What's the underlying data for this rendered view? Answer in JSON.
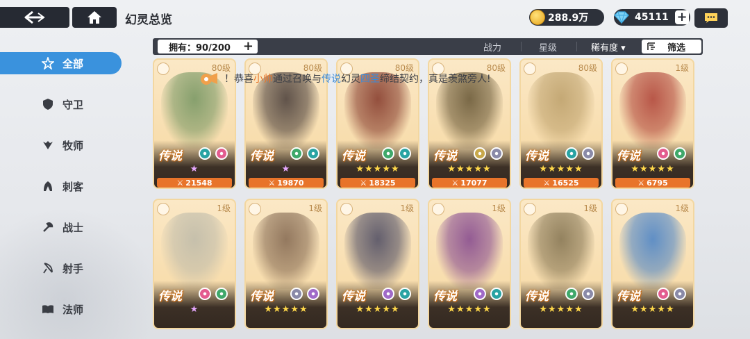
{
  "header": {
    "title": "幻灵总览",
    "gold": "288.9万",
    "gems": "45111",
    "plus": "+"
  },
  "filter_bar": {
    "owned_label": "拥有：90/200",
    "sort_power": "战力",
    "sort_star": "星级",
    "sort_rarity": "稀有度",
    "sort_rarity_arrow": "▾",
    "filter_label": "筛选"
  },
  "sidebar": {
    "items": [
      {
        "label": "全部",
        "icon": "star-outline-icon"
      },
      {
        "label": "守卫",
        "icon": "shield-icon"
      },
      {
        "label": "牧师",
        "icon": "wings-icon"
      },
      {
        "label": "刺客",
        "icon": "hood-icon"
      },
      {
        "label": "战士",
        "icon": "axe-icon"
      },
      {
        "label": "射手",
        "icon": "bow-icon"
      },
      {
        "label": "法师",
        "icon": "book-icon"
      }
    ]
  },
  "banner": {
    "prefix": "！恭喜",
    "player": "小帅",
    "mid": "通过召唤与",
    "rarity": "传说",
    "suffix1": "幻灵",
    "spirit": "四圣",
    "suffix2": "缔结契约，真是羡煞旁人!"
  },
  "colors": {
    "accent": "#3a92dd",
    "power_bar": "#e8742a",
    "dark": "#2d313a"
  },
  "cards": [
    {
      "level": "80级",
      "rarity": "传说",
      "stars": "★",
      "stars_color": "purple",
      "power": "21548",
      "elements": [
        "#29a3a3",
        "#e35c8f"
      ],
      "art": "#6a8f5a"
    },
    {
      "level": "80级",
      "rarity": "传说",
      "stars": "★",
      "stars_color": "purple",
      "power": "19870",
      "elements": [
        "#3fa86a",
        "#29a3a3"
      ],
      "art": "#3a2f2e"
    },
    {
      "level": "80级",
      "rarity": "传说",
      "stars": "★★★★★",
      "stars_color": "gold",
      "power": "18325",
      "elements": [
        "#3fa86a",
        "#29a3a3"
      ],
      "art": "#7a2a1e"
    },
    {
      "level": "80级",
      "rarity": "传说",
      "stars": "★★★★★",
      "stars_color": "gold",
      "power": "17077",
      "elements": [
        "#c8a84a",
        "#8a8aa8"
      ],
      "art": "#5a4a2a"
    },
    {
      "level": "80级",
      "rarity": "传说",
      "stars": "★★★★★",
      "stars_color": "gold",
      "power": "16525",
      "elements": [
        "#29a3a3",
        "#8a8aa8"
      ],
      "art": "#b79a64"
    },
    {
      "level": "1级",
      "rarity": "传说",
      "stars": "★★★★★",
      "stars_color": "gold",
      "power": "6795",
      "elements": [
        "#e35c8f",
        "#3fa86a"
      ],
      "art": "#a8342c"
    },
    {
      "level": "1级",
      "rarity": "传说",
      "stars": "★",
      "stars_color": "purple",
      "power": "",
      "elements": [
        "#e35c8f",
        "#3fa86a"
      ],
      "art": "#b9b7a8"
    },
    {
      "level": "1级",
      "rarity": "传说",
      "stars": "★★★★★",
      "stars_color": "gold",
      "power": "",
      "elements": [
        "#8a8aa8",
        "#a06ac8"
      ],
      "art": "#7a5e48"
    },
    {
      "level": "1级",
      "rarity": "传说",
      "stars": "★★★★★",
      "stars_color": "gold",
      "power": "",
      "elements": [
        "#a06ac8",
        "#29a3a3"
      ],
      "art": "#3e3e5a"
    },
    {
      "level": "1级",
      "rarity": "传说",
      "stars": "★★★★★",
      "stars_color": "gold",
      "power": "",
      "elements": [
        "#a06ac8",
        "#29a3a3"
      ],
      "art": "#7a3a8a"
    },
    {
      "level": "1级",
      "rarity": "传说",
      "stars": "★★★★★",
      "stars_color": "gold",
      "power": "",
      "elements": [
        "#3fa86a",
        "#8a8aa8"
      ],
      "art": "#7a6a48"
    },
    {
      "level": "1级",
      "rarity": "传说",
      "stars": "★★★★★",
      "stars_color": "gold",
      "power": "",
      "elements": [
        "#e35c8f",
        "#8a8aa8"
      ],
      "art": "#3a7ac8"
    }
  ]
}
